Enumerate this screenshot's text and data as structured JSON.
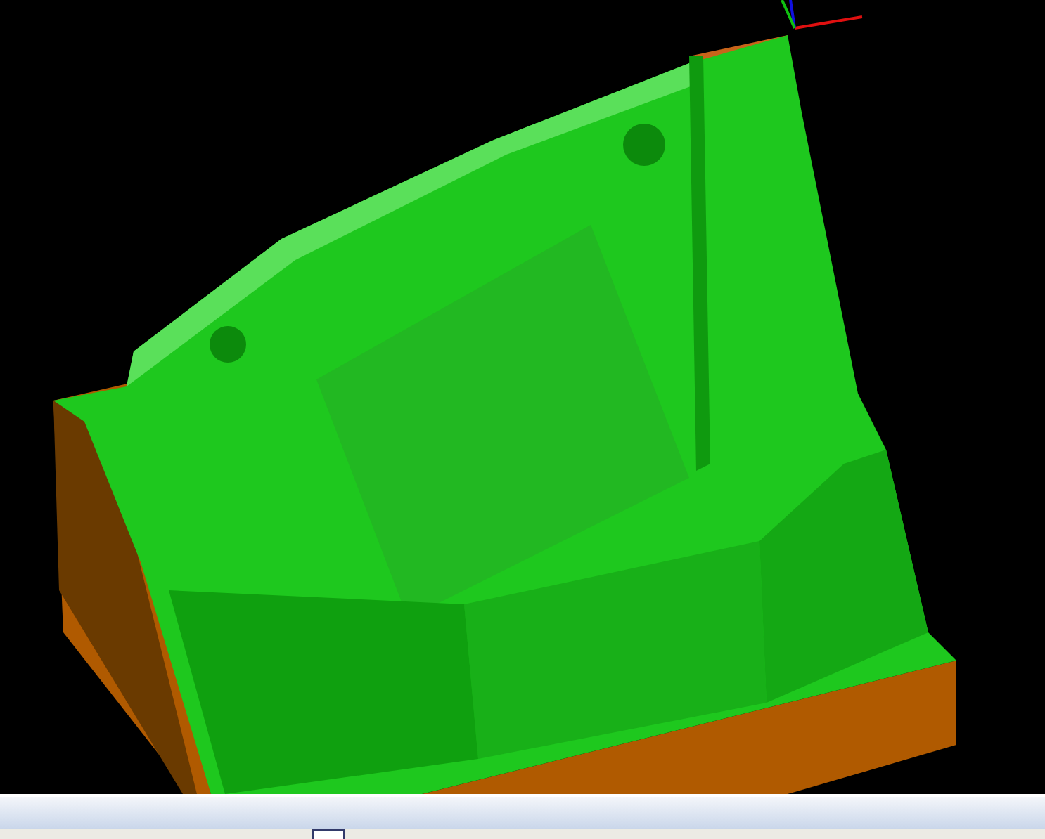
{
  "viewport": {
    "kind": "solid"
  }
}
